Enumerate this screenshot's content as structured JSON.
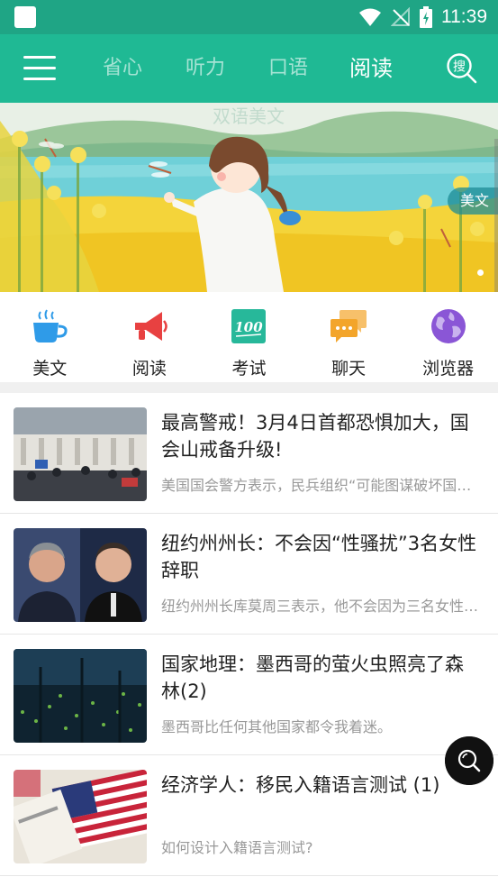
{
  "status_bar": {
    "time": "11:39",
    "icons": [
      "app-notification-icon",
      "wifi-icon",
      "no-signal-icon",
      "battery-charging-icon"
    ]
  },
  "app_bar": {
    "menu_icon": "hamburger-menu-icon",
    "tabs": [
      {
        "label": "省心",
        "active": false
      },
      {
        "label": "听力",
        "active": false
      },
      {
        "label": "口语",
        "active": false
      },
      {
        "label": "阅读",
        "active": true
      }
    ],
    "search_icon_text": "搜"
  },
  "banner": {
    "tag": "美文",
    "watermark": "双语美文",
    "colors": {
      "field": "#f4d43a",
      "water": "#6fd0d8",
      "hills": "#9bc69a"
    }
  },
  "categories": [
    {
      "label": "美文",
      "icon": "coffee-cup-icon",
      "color": "#2f9be8"
    },
    {
      "label": "阅读",
      "icon": "megaphone-icon",
      "color": "#e84141"
    },
    {
      "label": "考试",
      "icon": "score-100-icon",
      "color": "#27b89a"
    },
    {
      "label": "聊天",
      "icon": "chat-bubbles-icon",
      "color": "#f3a52b"
    },
    {
      "label": "浏览器",
      "icon": "globe-icon",
      "color": "#8a56d6"
    }
  ],
  "articles": [
    {
      "title": "最高警戒！3月4日首都恐惧加大，国会山戒备升级!",
      "summary": "美国国会警方表示，民兵组织“可能图谋破坏国会大厦”…"
    },
    {
      "title": "纽约州州长：不会因“性骚扰”3名女性辞职",
      "summary": "纽约州州长库莫周三表示，他不会因为三名女性指控…"
    },
    {
      "title": "国家地理：墨西哥的萤火虫照亮了森林(2)",
      "summary": "墨西哥比任何其他国家都令我着迷。"
    },
    {
      "title": "经济学人：移民入籍语言测试 (1)",
      "summary": "如何设计入籍语言测试?"
    }
  ],
  "fab": {
    "icon": "magnifier-icon"
  },
  "accent_color": "#1fb994"
}
